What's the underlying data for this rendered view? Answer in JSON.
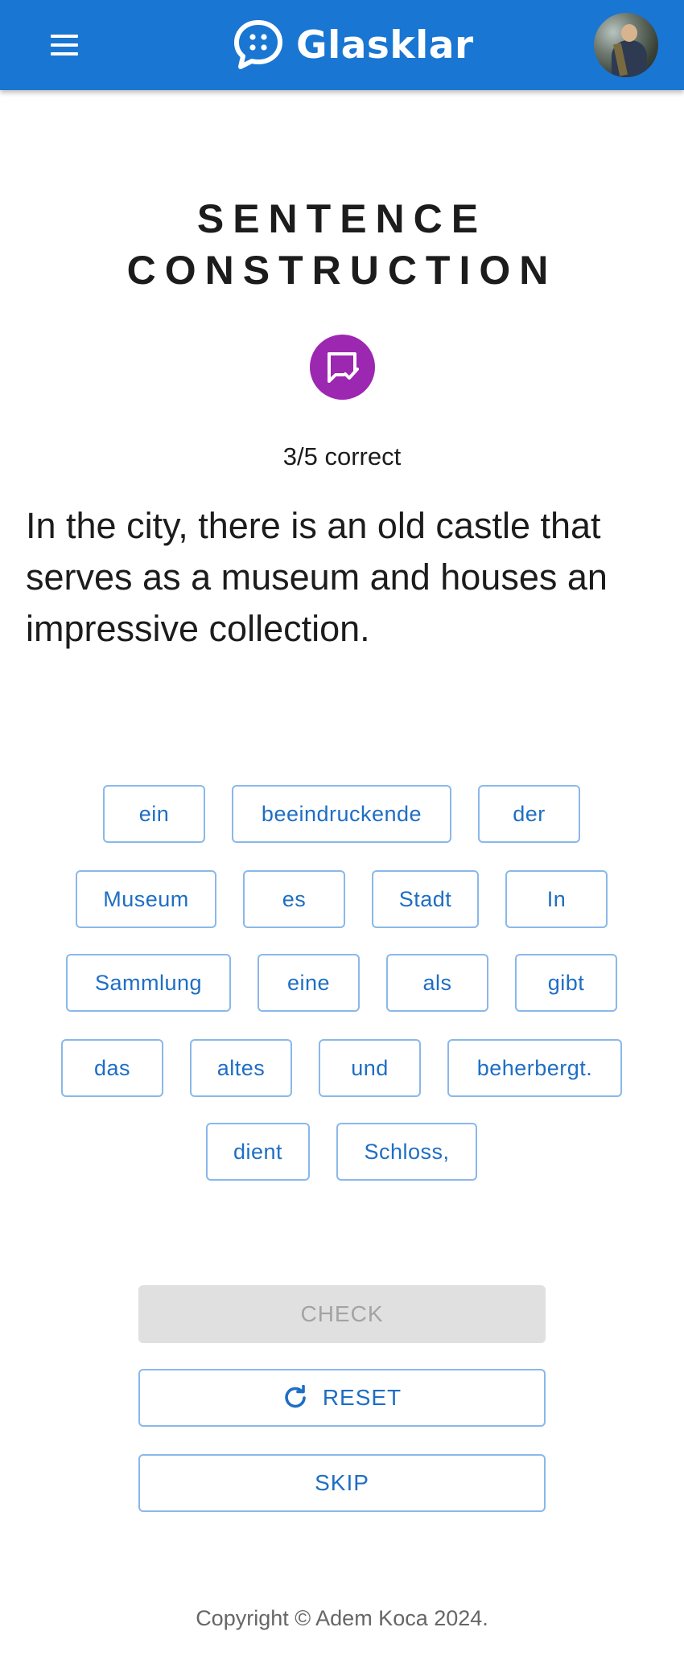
{
  "header": {
    "brand_name": "Glasklar",
    "menu_icon": "hamburger-menu-icon",
    "logo_icon": "chat-bubble-logo-icon",
    "avatar_icon": "user-avatar"
  },
  "exercise": {
    "title_line1": "SENTENCE",
    "title_line2": "CONSTRUCTION",
    "mode_icon": "chat-check-icon",
    "mode_color": "#9c27b0",
    "score": "3/5 correct",
    "sentence": "In the city, there is an old castle that serves as a museum and houses an impressive collection."
  },
  "words": [
    "ein",
    "beeindruckende",
    "der",
    "Museum",
    "es",
    "Stadt",
    "In",
    "Sammlung",
    "eine",
    "als",
    "gibt",
    "das",
    "altes",
    "und",
    "beherbergt.",
    "dient",
    "Schloss,"
  ],
  "actions": {
    "check_label": "CHECK",
    "reset_label": "RESET",
    "reset_icon": "refresh-icon",
    "skip_label": "SKIP"
  },
  "footer": {
    "copyright": "Copyright © Adem Koca 2024."
  },
  "colors": {
    "primary": "#1976d2",
    "chip_border": "#8ab8ea",
    "chip_text": "#1e6ec4",
    "disabled_bg": "#e0e0e0"
  }
}
